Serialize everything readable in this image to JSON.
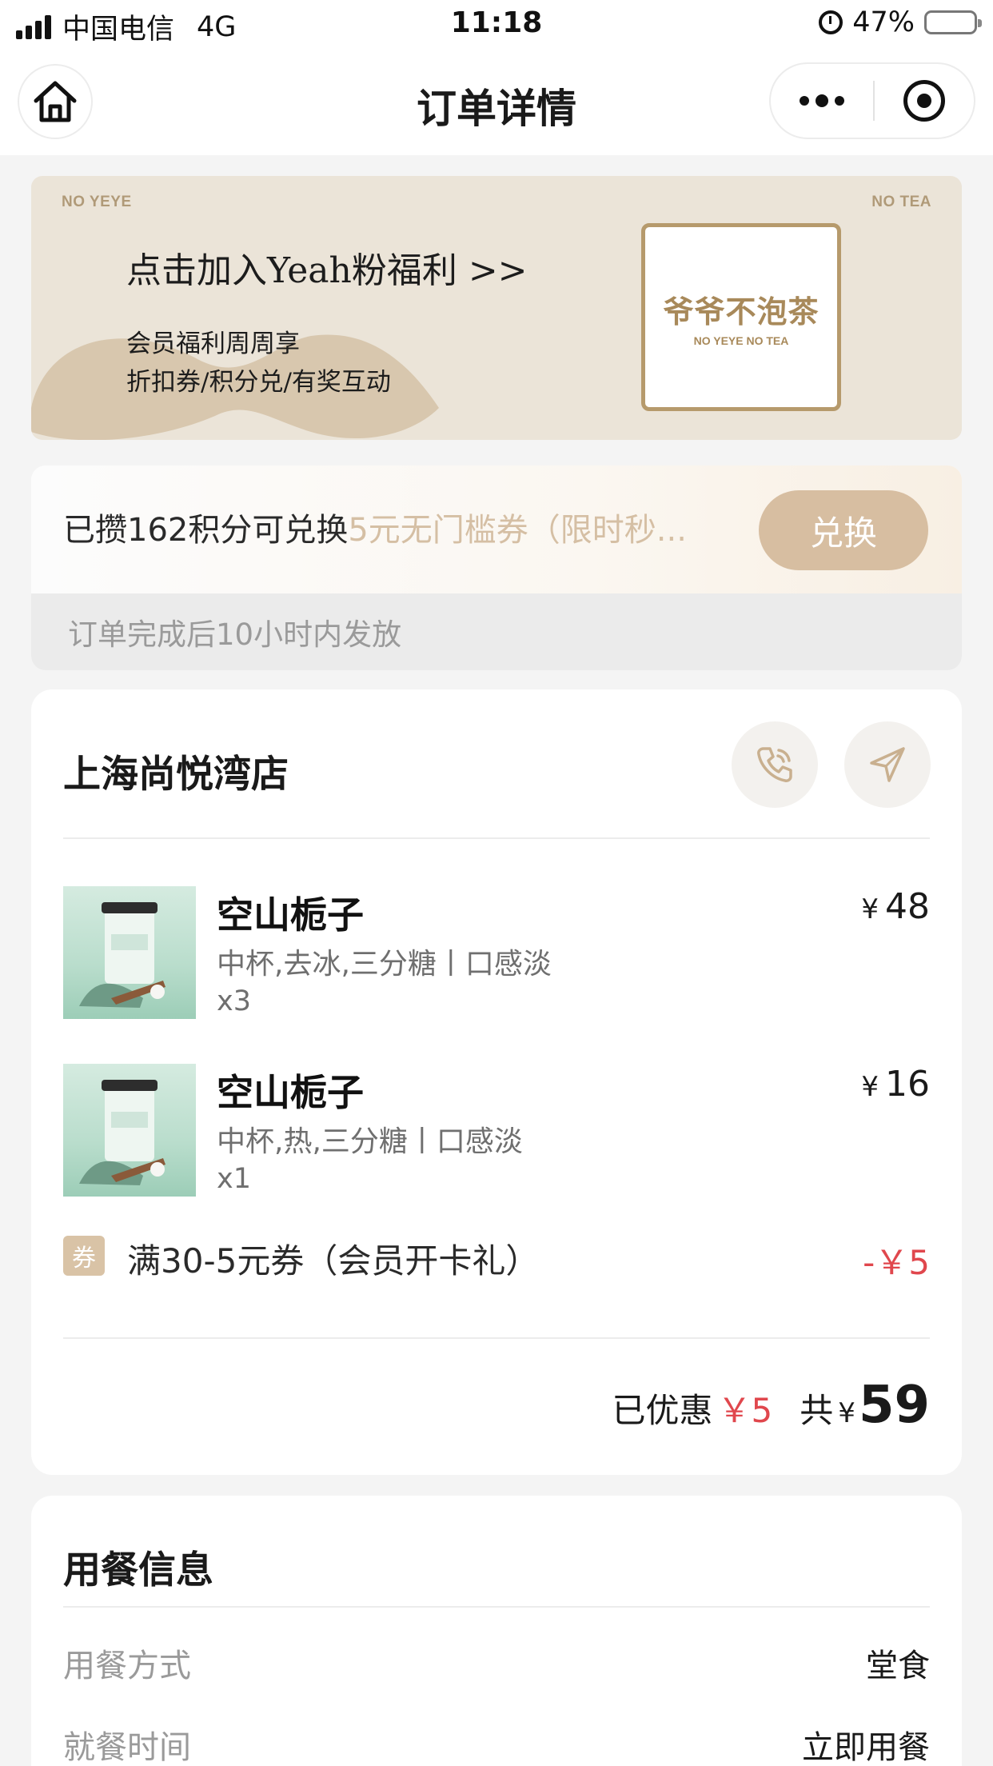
{
  "status_bar": {
    "carrier": "中国电信",
    "network": "4G",
    "time": "11:18",
    "battery": "47%"
  },
  "nav": {
    "title": "订单详情",
    "home_icon": "home-icon",
    "more_icon": "more-dots-icon",
    "close_icon": "target-close-icon"
  },
  "banner": {
    "corner_left": "NO YEYE",
    "corner_right": "NO TEA",
    "headline": "点击加入Yeah粉福利 >>",
    "line1": "会员福利周周享",
    "line2": "折扣券/积分兑/有奖互动",
    "logo_cn": "爷爷不泡茶",
    "logo_en": "NO YEYE NO TEA"
  },
  "points": {
    "text_prefix": "已攒162积分可兑换",
    "text_highlight": "5元无门槛券（限时秒...",
    "button": "兑换",
    "note": "订单完成后10小时内发放"
  },
  "order": {
    "store_name": "上海尚悦湾店",
    "phone_icon": "phone-icon",
    "navigate_icon": "navigate-icon",
    "items": [
      {
        "name": "空山栀子",
        "spec": "中杯,去冰,三分糖丨口感淡",
        "qty": "x3",
        "currency": "¥",
        "price": "48"
      },
      {
        "name": "空山栀子",
        "spec": "中杯,热,三分糖丨口感淡",
        "qty": "x1",
        "currency": "¥",
        "price": "16"
      }
    ],
    "coupon": {
      "badge": "券",
      "text": "满30-5元券（会员开卡礼）",
      "amount": "-￥5"
    },
    "saved_label": "已优惠",
    "saved_amount": "￥5",
    "total_label": "共",
    "total_currency": "¥",
    "total_amount": "59"
  },
  "dining": {
    "title": "用餐信息",
    "rows": [
      {
        "label": "用餐方式",
        "value": "堂食"
      },
      {
        "label": "就餐时间",
        "value": "立即用餐"
      }
    ]
  },
  "colors": {
    "accent_gold": "#d7bea1",
    "price_red": "#e0474d",
    "banner_bg": "#ebe4d8"
  }
}
